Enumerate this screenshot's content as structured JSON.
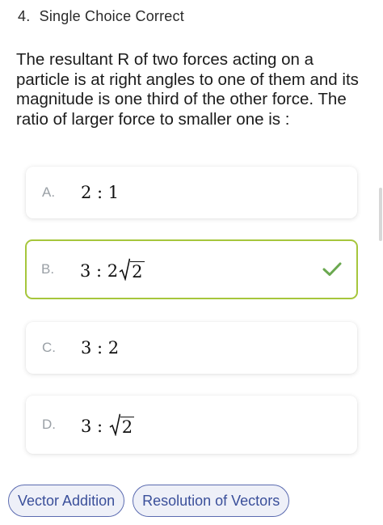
{
  "question": {
    "number": "4.",
    "type": "Single Choice Correct",
    "text": "The resultant R of two forces acting on a particle is at right angles to one of them and its magnitude is one third of the other force. The ratio of larger force to smaller one is :"
  },
  "options": [
    {
      "letter": "A.",
      "prefix": "2 : 1",
      "radicand": ""
    },
    {
      "letter": "B.",
      "prefix": "3 : 2",
      "radicand": "2",
      "selected": true
    },
    {
      "letter": "C.",
      "prefix": "3 : 2",
      "radicand": ""
    },
    {
      "letter": "D.",
      "prefix": "3 : ",
      "radicand": "2"
    }
  ],
  "tags": [
    "Vector Addition",
    "Resolution of Vectors"
  ],
  "colors": {
    "selected_border": "#a6c63c",
    "check": "#6aa84f",
    "tag_border": "#5b6bb0",
    "tag_text": "#3a4f9a",
    "tag_bg": "#eef0f8"
  },
  "icons": {
    "correct": "check-icon"
  }
}
